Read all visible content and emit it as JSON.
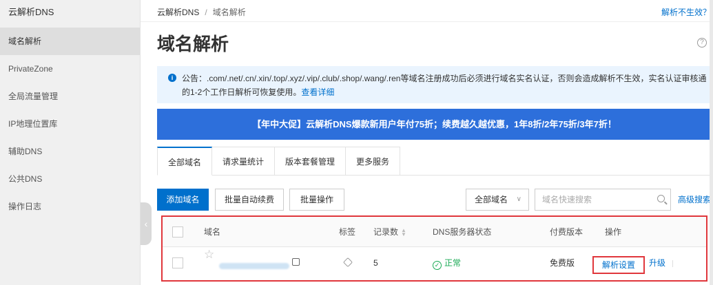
{
  "sidebar": {
    "title": "云解析DNS",
    "items": [
      {
        "label": "域名解析",
        "active": true
      },
      {
        "label": "PrivateZone",
        "active": false
      },
      {
        "label": "全局流量管理",
        "active": false
      },
      {
        "label": "IP地理位置库",
        "active": false
      },
      {
        "label": "辅助DNS",
        "active": false
      },
      {
        "label": "公共DNS",
        "active": false
      },
      {
        "label": "操作日志",
        "active": false
      }
    ]
  },
  "breadcrumb": {
    "root": "云解析DNS",
    "separator": "/",
    "current": "域名解析"
  },
  "top_link": "解析不生效？",
  "page_title": "域名解析",
  "help_icon": "?",
  "notice": {
    "icon": "info-icon",
    "line1": "公告：.com/.net/.cn/.xin/.top/.xyz/.vip/.club/.shop/.wang/.ren等域名注册成功后必须进行域名实名认证，否则会造成解析不生效，实名认证审核通",
    "line2": "的1-2个工作日解析可恢复使用。",
    "link": "查看详细"
  },
  "banner": "【年中大促】云解析DNS爆款新用户年付75折；续费越久越优惠，1年8折/2年75折/3年7折！",
  "tabs": [
    {
      "label": "全部域名",
      "active": true
    },
    {
      "label": "请求量统计",
      "active": false
    },
    {
      "label": "版本套餐管理",
      "active": false
    },
    {
      "label": "更多服务",
      "active": false
    }
  ],
  "toolbar": {
    "add_domain": "添加域名",
    "batch_renew": "批量自动续费",
    "batch_ops": "批量操作",
    "filter_select": "全部域名",
    "search_placeholder": "域名快速搜索",
    "advanced_search": "高级搜索"
  },
  "table": {
    "headers": {
      "domain": "域名",
      "tag": "标签",
      "records": "记录数",
      "dns_status": "DNS服务器状态",
      "plan": "付费版本",
      "actions": "操作"
    },
    "rows": [
      {
        "records": "5",
        "dns_status": "正常",
        "plan": "免费版",
        "action_primary": "解析设置",
        "action_secondary": "升级"
      }
    ]
  },
  "colors": {
    "accent": "#0070cc",
    "banner": "#2d6fdb",
    "highlight": "#e0363b",
    "ok": "#1aaa55"
  }
}
